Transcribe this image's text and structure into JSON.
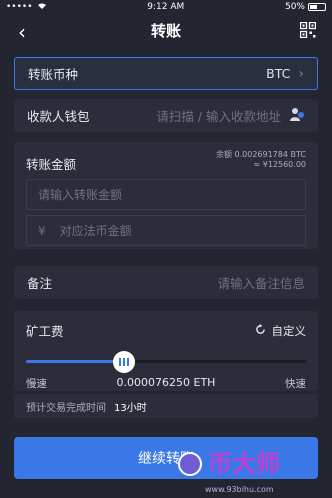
{
  "statusbar": {
    "time": "9:12 AM",
    "battery": "50%"
  },
  "navbar": {
    "title": "转账"
  },
  "coin_row": {
    "label": "转账币种",
    "value": "BTC"
  },
  "receiver_row": {
    "label": "收款人钱包",
    "placeholder": "请扫描 / 输入收款地址"
  },
  "amount": {
    "title": "转账金额",
    "balance_line1": "余额 0.002691784 BTC",
    "balance_line2": "≈ ¥12560.00",
    "amount_placeholder": "请输入转账金额",
    "fiat_symbol": "¥",
    "fiat_placeholder": "对应法币金额"
  },
  "memo_row": {
    "label": "备注",
    "placeholder": "请输入备注信息"
  },
  "fee": {
    "title": "矿工费",
    "custom_label": "自定义",
    "slow_label": "慢速",
    "fast_label": "快速",
    "fee_value": "0.000076250 ETH",
    "slider_level": 0.35
  },
  "estimate": {
    "label": "预计交易完成时间",
    "value": "13小时"
  },
  "next_button": {
    "label": "继续转账"
  },
  "watermark": {
    "text": "币大师",
    "url": "www.93bihu.com"
  },
  "colors": {
    "accent": "#3b78e7",
    "background": "#232530",
    "panel": "#2b2e3a"
  }
}
